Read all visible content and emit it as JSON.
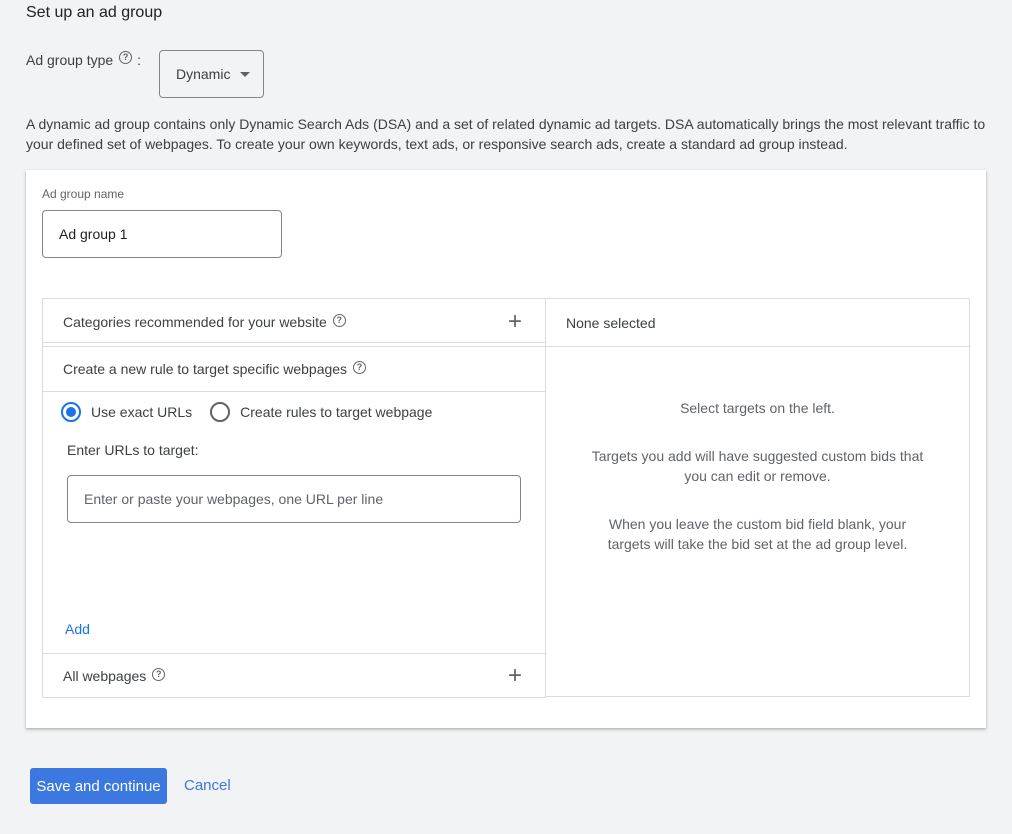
{
  "page": {
    "title": "Set up an ad group",
    "ad_group_type_label": "Ad group type",
    "ad_group_type_colon": ":",
    "ad_group_type_value": "Dynamic",
    "description": "A dynamic ad group contains only Dynamic Search Ads (DSA) and a set of related dynamic ad targets. DSA automatically brings the most relevant traffic to your defined set of webpages. To create your own keywords, text ads, or responsive search ads, create a standard ad group instead."
  },
  "card": {
    "name_label": "Ad group name",
    "name_value": "Ad group 1",
    "left": {
      "categories_label": "Categories recommended for your website",
      "rule_label": "Create a new rule to target specific webpages",
      "radio_options": [
        {
          "label": "Use exact URLs",
          "selected": true
        },
        {
          "label": "Create rules to target webpage",
          "selected": false
        }
      ],
      "url_label": "Enter URLs to target:",
      "url_placeholder": "Enter or paste your webpages, one URL per line",
      "add_label": "Add",
      "all_webpages_label": "All webpages"
    },
    "right": {
      "header": "None selected",
      "text_1": "Select targets on the left.",
      "text_2": "Targets you add will have suggested custom bids that you can edit or remove.",
      "text_3": "When you leave the custom bid field blank, your targets will take the bid set at the ad group level."
    }
  },
  "icons": {
    "help": "?",
    "plus": "+"
  },
  "actions": {
    "save_label": "Save and continue",
    "cancel_label": "Cancel"
  },
  "colors": {
    "accent": "#1a73e8",
    "save_button": "#3b78e0",
    "background": "#f1f3f4"
  }
}
